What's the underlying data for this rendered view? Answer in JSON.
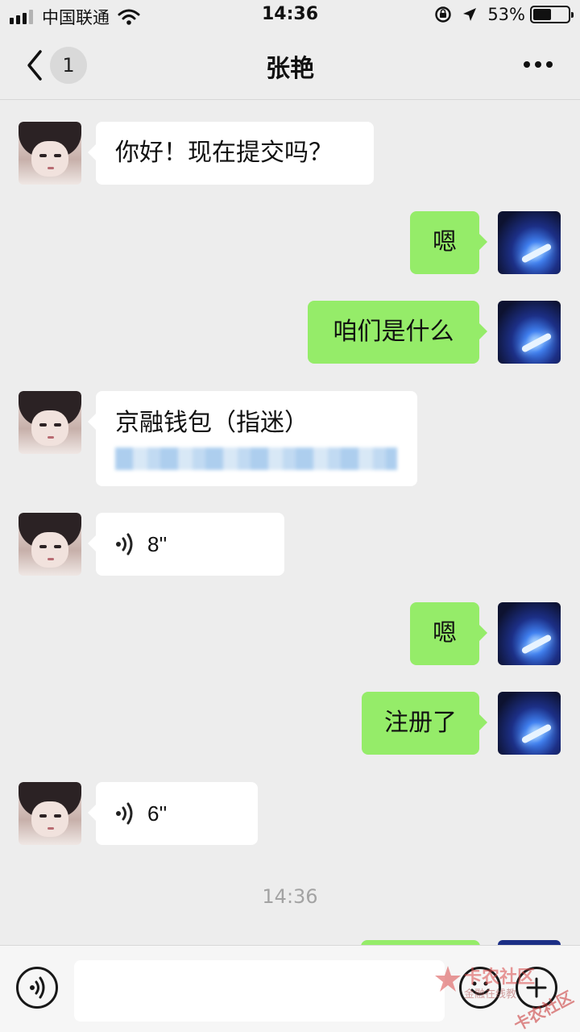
{
  "status_bar": {
    "carrier": "中国联通",
    "time": "14:36",
    "battery": "53%",
    "battery_level": 0.53,
    "icons": [
      "signal-icon",
      "wifi-icon",
      "orientation-lock-icon",
      "location-icon",
      "battery-icon"
    ]
  },
  "nav": {
    "back_icon": "chevron-left-icon",
    "unread_count": "1",
    "title": "张艳",
    "more_icon": "more-dots-icon"
  },
  "messages": [
    {
      "side": "left",
      "type": "text",
      "text": "你好！现在提交吗？"
    },
    {
      "side": "right",
      "type": "text",
      "text": "嗯"
    },
    {
      "side": "right",
      "type": "text",
      "text": "咱们是什么"
    },
    {
      "side": "left",
      "type": "link",
      "text": "京融钱包（指迷）"
    },
    {
      "side": "left",
      "type": "voice",
      "text": "8''"
    },
    {
      "side": "right",
      "type": "text",
      "text": "嗯"
    },
    {
      "side": "right",
      "type": "text",
      "text": "注册了"
    },
    {
      "side": "left",
      "type": "voice",
      "text": "6''"
    }
  ],
  "timestamp": "14:36",
  "input_bar": {
    "voice_icon": "voice-icon",
    "emoji_icon": "emoji-icon",
    "plus_icon": "plus-icon",
    "input_value": ""
  },
  "watermark": {
    "line1": "卡农社区",
    "line2": "金融在线教",
    "line3": "卡农社区"
  },
  "colors": {
    "background": "#ededed",
    "outgoing_bubble": "#95ec69",
    "incoming_bubble": "#ffffff"
  }
}
